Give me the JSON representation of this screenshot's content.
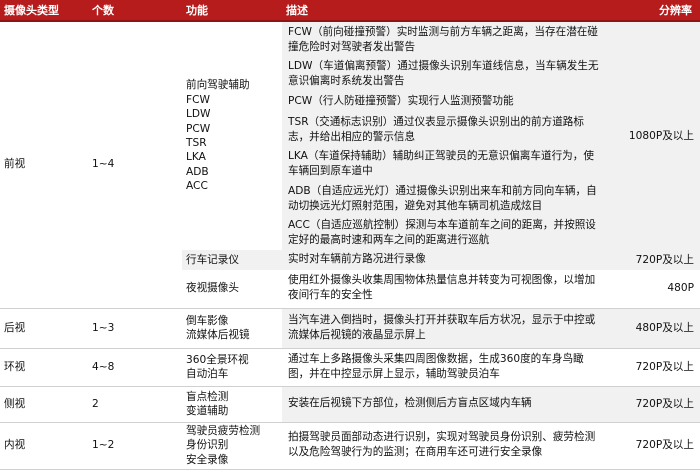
{
  "headers": {
    "camera_type": "摄像头类型",
    "count": "个数",
    "function": "功能",
    "description": "描述",
    "resolution": "分辨率"
  },
  "front": {
    "type": "前视",
    "count": "1~4",
    "adas_functions": [
      "前向驾驶辅助",
      "FCW",
      "LDW",
      "PCW",
      "TSR",
      "LKA",
      "ADB",
      "ACC"
    ],
    "adas_descriptions": [
      "FCW（前向碰撞预警）实时监测与前方车辆之距离，当存在潜在碰撞危险时对驾驶者发出警告",
      "LDW（车道偏离预警）通过摄像头识别车道线信息，当车辆发生无意识偏离时系统发出警告",
      "PCW（行人防碰撞预警）实现行人监测预警功能",
      "TSR（交通标志识别）通过仪表显示摄像头识别出的前方道路标志，并给出相应的警示信息",
      "LKA（车道保持辅助）辅助纠正驾驶员的无意识偏离车道行为，使车辆回到原车道中",
      "ADB（自适应远光灯）通过摄像头识别出来车和前方同向车辆，自动切换远光灯照射范围，避免对其他车辆司机造成炫目",
      "ACC（自适应巡航控制）探测与本车道前车之间的距离，并按照设定好的最高时速和两车之间的距离进行巡航"
    ],
    "adas_resolution": "1080P及以上",
    "dvr_function": "行车记录仪",
    "dvr_description": "实时对车辆前方路况进行录像",
    "dvr_resolution": "720P及以上",
    "night_function": "夜视摄像头",
    "night_description": "使用红外摄像头收集周围物体热量信息并转变为可视图像，以增加夜间行车的安全性",
    "night_resolution": "480P"
  },
  "rear": {
    "type": "后视",
    "count": "1~3",
    "function": [
      "倒车影像",
      "流媒体后视镜"
    ],
    "description": "当汽车进入倒挡时，摄像头打开并获取车后方状况，显示于中控或流媒体后视镜的液晶显示屏上",
    "resolution": "480P及以上"
  },
  "surround": {
    "type": "环视",
    "count": "4~8",
    "function": [
      "360全景环视",
      "自动泊车"
    ],
    "description": "通过车上多路摄像头采集四周图像数据，生成360度的车身鸟瞰图，并在中控显示屏上显示，辅助驾驶员泊车",
    "resolution": "720P及以上"
  },
  "side": {
    "type": "侧视",
    "count": "2",
    "function": [
      "盲点检测",
      "变道辅助"
    ],
    "description": "安装在后视镜下方部位，检测侧后方盲点区域内车辆",
    "resolution": "720P及以上"
  },
  "interior": {
    "type": "内视",
    "count": "1~2",
    "function": [
      "驾驶员疲劳检测",
      "身份识别",
      "安全录像"
    ],
    "description": "拍摄驾驶员面部动态进行识别，实现对驾驶员身份识别、疲劳检测以及危险驾驶行为的监测；在商用车还可进行安全录像",
    "resolution": "720P及以上"
  }
}
